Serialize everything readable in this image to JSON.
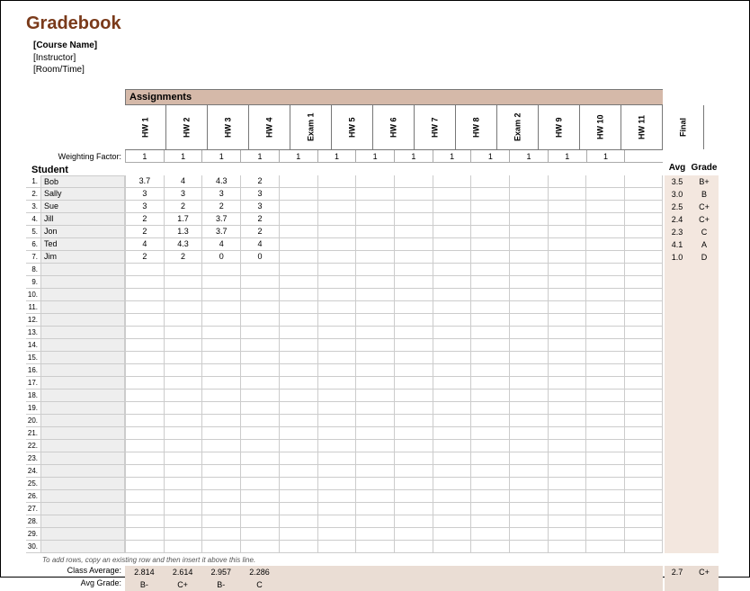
{
  "title": "Gradebook",
  "meta": {
    "course": "[Course Name]",
    "instructor": "[Instructor]",
    "roomtime": "[Room/Time]"
  },
  "assignments_label": "Assignments",
  "weighting_label": "Weighting Factor:",
  "columns": [
    "HW 1",
    "HW 2",
    "HW 3",
    "HW 4",
    "Exam 1",
    "HW 5",
    "HW 6",
    "HW 7",
    "HW 8",
    "Exam 2",
    "HW 9",
    "HW 10",
    "HW 11",
    "Final"
  ],
  "weights": [
    "1",
    "1",
    "1",
    "1",
    "1",
    "1",
    "1",
    "1",
    "1",
    "1",
    "1",
    "1",
    "1",
    ""
  ],
  "student_label": "Student",
  "avg_label": "Avg",
  "grade_label": "Grade",
  "total_rows": 30,
  "students": [
    {
      "n": "1.",
      "name": "Bob",
      "scores": [
        "3.7",
        "4",
        "4.3",
        "2",
        "",
        "",
        "",
        "",
        "",
        "",
        "",
        "",
        "",
        ""
      ],
      "avg": "3.5",
      "grade": "B+"
    },
    {
      "n": "2.",
      "name": "Sally",
      "scores": [
        "3",
        "3",
        "3",
        "3",
        "",
        "",
        "",
        "",
        "",
        "",
        "",
        "",
        "",
        ""
      ],
      "avg": "3.0",
      "grade": "B"
    },
    {
      "n": "3.",
      "name": "Sue",
      "scores": [
        "3",
        "2",
        "2",
        "3",
        "",
        "",
        "",
        "",
        "",
        "",
        "",
        "",
        "",
        ""
      ],
      "avg": "2.5",
      "grade": "C+"
    },
    {
      "n": "4.",
      "name": "Jill",
      "scores": [
        "2",
        "1.7",
        "3.7",
        "2",
        "",
        "",
        "",
        "",
        "",
        "",
        "",
        "",
        "",
        ""
      ],
      "avg": "2.4",
      "grade": "C+"
    },
    {
      "n": "5.",
      "name": "Jon",
      "scores": [
        "2",
        "1.3",
        "3.7",
        "2",
        "",
        "",
        "",
        "",
        "",
        "",
        "",
        "",
        "",
        ""
      ],
      "avg": "2.3",
      "grade": "C"
    },
    {
      "n": "6.",
      "name": "Ted",
      "scores": [
        "4",
        "4.3",
        "4",
        "4",
        "",
        "",
        "",
        "",
        "",
        "",
        "",
        "",
        "",
        ""
      ],
      "avg": "4.1",
      "grade": "A"
    },
    {
      "n": "7.",
      "name": "Jim",
      "scores": [
        "2",
        "2",
        "0",
        "0",
        "",
        "",
        "",
        "",
        "",
        "",
        "",
        "",
        "",
        ""
      ],
      "avg": "1.0",
      "grade": "D"
    }
  ],
  "footer_note": "To add rows, copy an existing row and then insert it above this line.",
  "class_avg_label": "Class Average:",
  "class_avg": [
    "2.814",
    "2.614",
    "2.957",
    "2.286",
    "",
    "",
    "",
    "",
    "",
    "",
    "",
    "",
    "",
    ""
  ],
  "avg_grade_label": "Avg Grade:",
  "avg_grade": [
    "B-",
    "C+",
    "B-",
    "C",
    "",
    "",
    "",
    "",
    "",
    "",
    "",
    "",
    "",
    ""
  ],
  "overall_avg": "2.7",
  "overall_grade": "C+"
}
